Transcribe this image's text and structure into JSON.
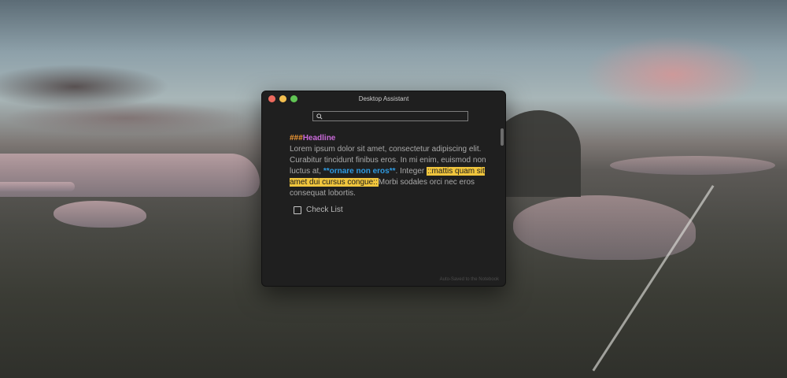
{
  "window": {
    "title": "Desktop Assistant",
    "traffic_lights": {
      "close_color": "#ed6a5e",
      "minimize_color": "#f4bf4f",
      "zoom_color": "#61c554"
    }
  },
  "search": {
    "icon": "search-icon",
    "value": "",
    "placeholder": ""
  },
  "editor": {
    "heading_prefix": "###",
    "heading_text": "Headline",
    "paragraph_start": "Lorem ipsum dolor sit amet, consectetur adipiscing elit. Curabitur tincidunt finibus eros. In mi enim, euismod non luctus at,",
    "bold_text": "**ornare non eros**",
    "paragraph_middle": ". Integer",
    "highlight_text": "::mattis quam sit amet dui cursus congue::",
    "paragraph_end": "Morbi sodales orci nec eros consequat lobortis."
  },
  "checklist": {
    "label": "Check List",
    "checked": false
  },
  "status": {
    "text": "Auto-Saved to the Notebook"
  },
  "colors": {
    "window_bg": "#1f1f1f",
    "heading_marker": "#f39a35",
    "heading": "#c96ad8",
    "bold_link": "#2f9be2",
    "highlight": "#f0c53d"
  }
}
